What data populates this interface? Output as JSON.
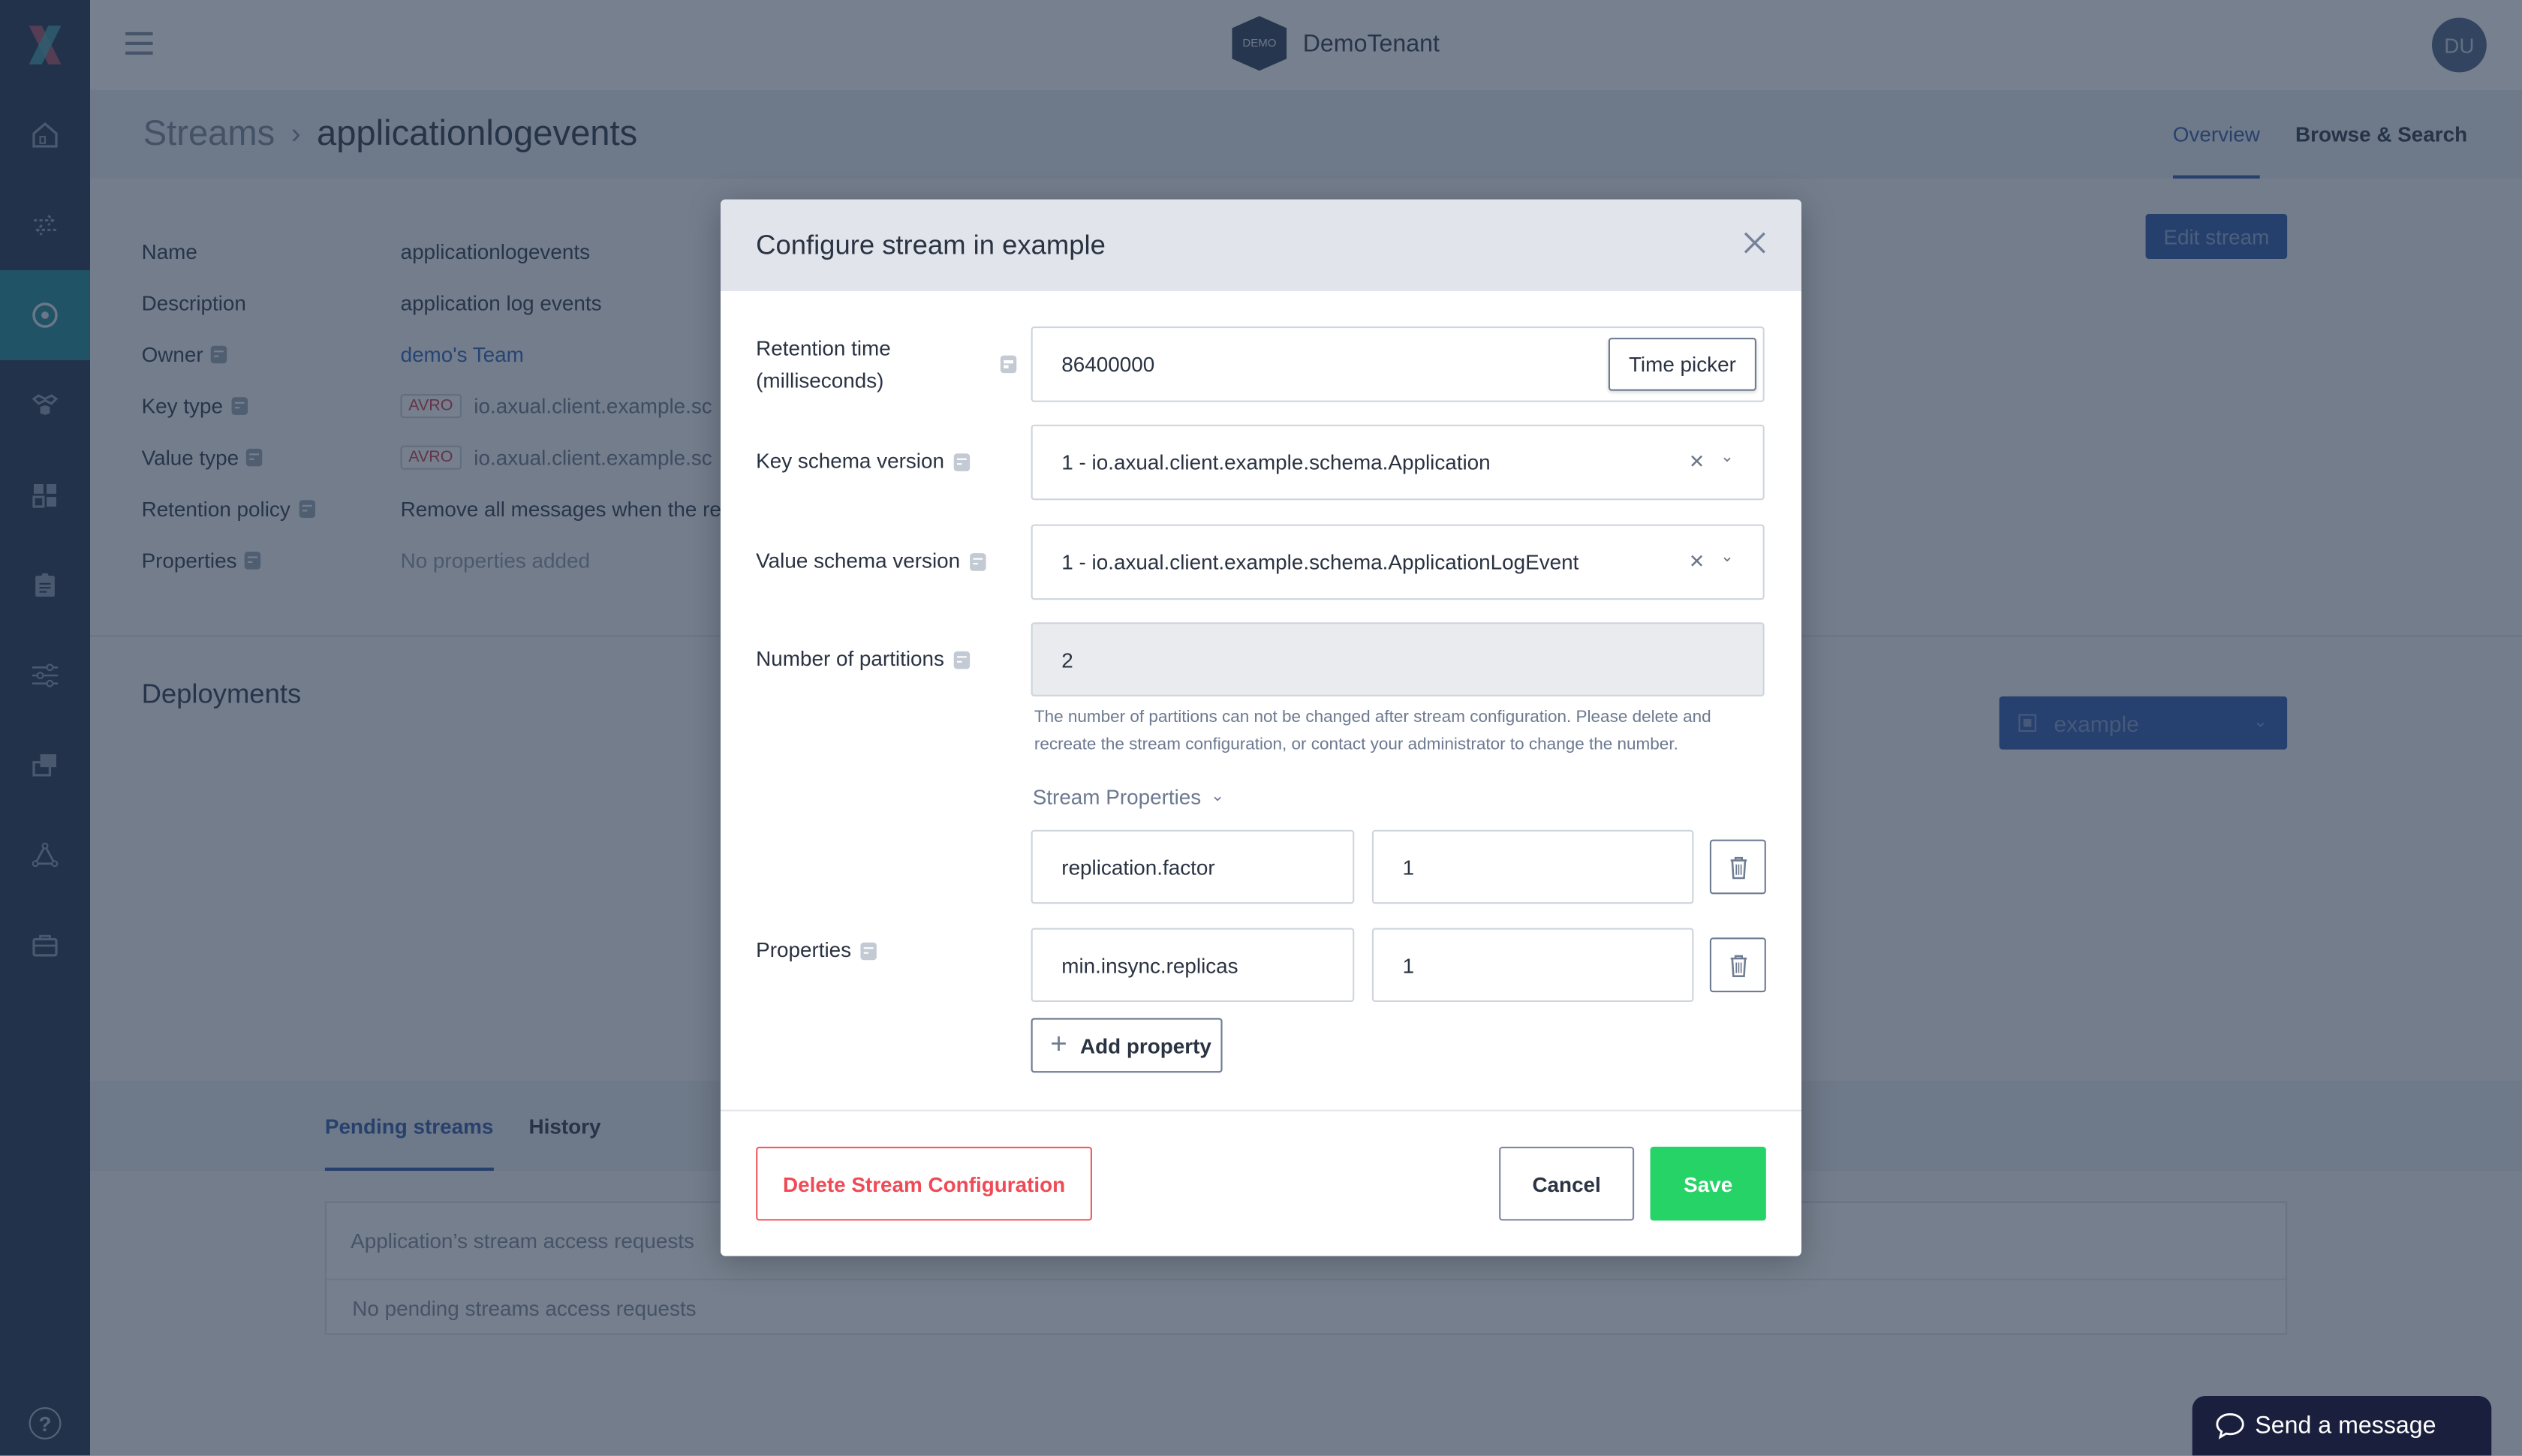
{
  "colors": {
    "sidebar_bg": "#203450",
    "sidebar_active": "#1f8a96",
    "accent": "#2d5aa7",
    "save_green": "#25d366",
    "danger_red": "#ef4a55",
    "overlay": "rgba(35,50,72,0.62)"
  },
  "sidebar": {
    "logo": "axual-logo",
    "items": [
      {
        "icon": "home-icon",
        "active": false
      },
      {
        "icon": "exchange-arrows-icon",
        "active": false
      },
      {
        "icon": "stream-target-icon",
        "active": true
      },
      {
        "icon": "applications-icon",
        "active": false
      },
      {
        "icon": "dashboard-grid-icon",
        "active": false
      },
      {
        "icon": "clipboard-icon",
        "active": false
      },
      {
        "icon": "sliders-icon",
        "active": false
      },
      {
        "icon": "environments-icon",
        "active": false
      },
      {
        "icon": "network-icon",
        "active": false
      },
      {
        "icon": "briefcase-icon",
        "active": false
      }
    ],
    "help_label": "?"
  },
  "topbar": {
    "tenant_badge": "DEMO",
    "tenant_name": "DemoTenant",
    "avatar_initials": "DU"
  },
  "page": {
    "breadcrumb_root": "Streams",
    "breadcrumb_sep": "›",
    "breadcrumb_current": "applicationlogevents",
    "tabs": [
      {
        "label": "Overview",
        "active": true
      },
      {
        "label": "Browse & Search",
        "active": false
      }
    ],
    "edit_button": "Edit stream"
  },
  "details": {
    "rows": [
      {
        "label": "Name",
        "value": "applicationlogevents",
        "info": false
      },
      {
        "label": "Description",
        "value": "application log events",
        "info": false
      },
      {
        "label": "Owner",
        "value": "demo's Team",
        "info": true
      },
      {
        "label": "Key type",
        "badge": "AVRO",
        "value": "io.axual.client.example.sc",
        "info": true
      },
      {
        "label": "Value type",
        "badge": "AVRO",
        "value": "io.axual.client.example.sc",
        "info": true
      },
      {
        "label": "Retention policy",
        "value": "Remove all messages when the re",
        "info": true
      },
      {
        "label": "Properties",
        "value": "No properties added",
        "info": true
      }
    ]
  },
  "deployments": {
    "title": "Deployments",
    "environment_select": "example",
    "tabs": [
      {
        "label": "Pending streams",
        "active": true
      },
      {
        "label": "History",
        "active": false
      }
    ],
    "table_header": "Application’s stream access requests",
    "table_empty": "No pending streams access requests"
  },
  "chat": {
    "label": "Send a message"
  },
  "modal": {
    "title": "Configure stream in example",
    "retention": {
      "label_line1": "Retention time",
      "label_line2": "(milliseconds)",
      "value": "86400000",
      "time_picker": "Time picker"
    },
    "key_schema": {
      "label": "Key schema version",
      "value": "1 - io.axual.client.example.schema.Application"
    },
    "value_schema": {
      "label": "Value schema version",
      "value": "1 - io.axual.client.example.schema.ApplicationLogEvent"
    },
    "partitions": {
      "label": "Number of partitions",
      "value": "2",
      "hint": "The number of partitions can not be changed after stream configuration. Please delete and recreate the stream configuration, or contact your administrator to change the number."
    },
    "stream_properties_toggle": "Stream Properties",
    "properties_label": "Properties",
    "properties": [
      {
        "key": "replication.factor",
        "value": "1"
      },
      {
        "key": "min.insync.replicas",
        "value": "1"
      }
    ],
    "add_property": "Add property",
    "delete_button": "Delete Stream Configuration",
    "cancel_button": "Cancel",
    "save_button": "Save"
  }
}
